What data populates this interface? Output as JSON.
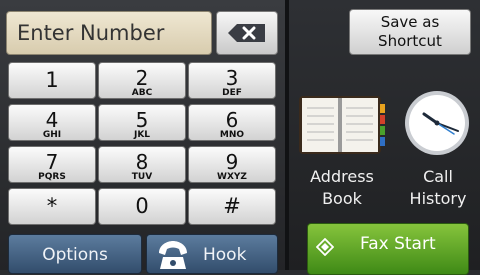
{
  "display": {
    "placeholder": "Enter Number"
  },
  "icons": {
    "backspace": "backspace-icon",
    "hook": "telephone-handset-icon",
    "address_book": "address-book-icon",
    "call_history": "clock-icon",
    "fax_start": "start-diamond-icon"
  },
  "keypad": [
    {
      "digit": "1",
      "letters": ""
    },
    {
      "digit": "2",
      "letters": "ABC"
    },
    {
      "digit": "3",
      "letters": "DEF"
    },
    {
      "digit": "4",
      "letters": "GHI"
    },
    {
      "digit": "5",
      "letters": "JKL"
    },
    {
      "digit": "6",
      "letters": "MNO"
    },
    {
      "digit": "7",
      "letters": "PQRS"
    },
    {
      "digit": "8",
      "letters": "TUV"
    },
    {
      "digit": "9",
      "letters": "WXYZ"
    },
    {
      "digit": "*",
      "letters": ""
    },
    {
      "digit": "0",
      "letters": ""
    },
    {
      "digit": "#",
      "letters": ""
    }
  ],
  "bottom": {
    "options_label": "Options",
    "hook_label": "Hook"
  },
  "right": {
    "shortcut_line1": "Save as",
    "shortcut_line2": "Shortcut",
    "address_line1": "Address",
    "address_line2": "Book",
    "history_line1": "Call",
    "history_line2": "History",
    "fax_start_label": "Fax Start"
  },
  "colors": {
    "fax_start": "#5aa425",
    "blue_buttons": "#4a6a8c",
    "display_field": "#e6dcc2"
  }
}
